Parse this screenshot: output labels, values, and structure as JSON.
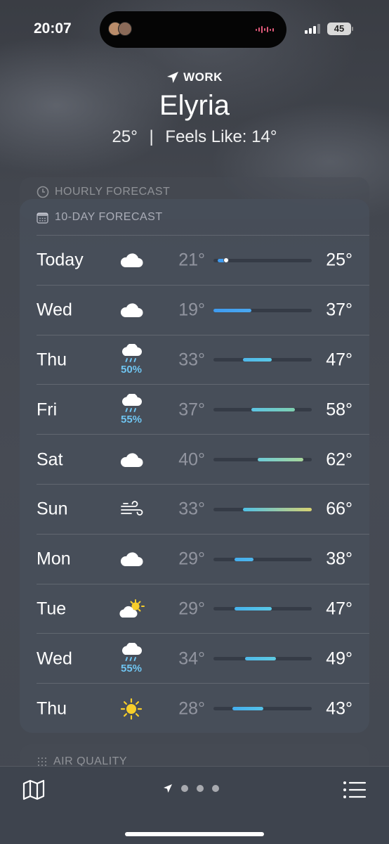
{
  "status": {
    "time": "20:07",
    "battery": "45"
  },
  "header": {
    "location_label": "WORK",
    "city": "Elyria",
    "current_temp": "25°",
    "separator": "|",
    "feels_like": "Feels Like: 14°"
  },
  "hourly": {
    "title": "HOURLY FORECAST"
  },
  "forecast": {
    "title": "10-DAY FORECAST",
    "range_min": 19,
    "range_max": 66,
    "days": [
      {
        "day": "Today",
        "icon": "cloud-icon",
        "precip": "",
        "low": "21°",
        "high": "25°",
        "low_value": 21,
        "high_value": 25,
        "current_value": 25,
        "colors": [
          "#3e9bf0",
          "#3e9bf0"
        ]
      },
      {
        "day": "Wed",
        "icon": "cloud-icon",
        "precip": "",
        "low": "19°",
        "high": "37°",
        "low_value": 19,
        "high_value": 37,
        "current_value": null,
        "colors": [
          "#3e9bf0",
          "#4aa8f0"
        ]
      },
      {
        "day": "Thu",
        "icon": "rain-cloud-icon",
        "precip": "50%",
        "low": "33°",
        "high": "47°",
        "low_value": 33,
        "high_value": 47,
        "current_value": null,
        "colors": [
          "#4fb7ea",
          "#5ac8e6"
        ]
      },
      {
        "day": "Fri",
        "icon": "rain-cloud-icon",
        "precip": "55%",
        "low": "37°",
        "high": "58°",
        "low_value": 37,
        "high_value": 58,
        "current_value": null,
        "colors": [
          "#5cc4e4",
          "#7fd0b0"
        ]
      },
      {
        "day": "Sat",
        "icon": "cloud-icon",
        "precip": "",
        "low": "40°",
        "high": "62°",
        "low_value": 40,
        "high_value": 62,
        "current_value": null,
        "colors": [
          "#6ccbd8",
          "#a8d69a"
        ]
      },
      {
        "day": "Sun",
        "icon": "wind-icon",
        "precip": "",
        "low": "33°",
        "high": "66°",
        "low_value": 33,
        "high_value": 66,
        "current_value": null,
        "colors": [
          "#4fc1e6",
          "#d8d271"
        ]
      },
      {
        "day": "Mon",
        "icon": "cloud-icon",
        "precip": "",
        "low": "29°",
        "high": "38°",
        "low_value": 29,
        "high_value": 38,
        "current_value": null,
        "colors": [
          "#44aeee",
          "#4eb6ec"
        ]
      },
      {
        "day": "Tue",
        "icon": "partly-sunny-icon",
        "precip": "",
        "low": "29°",
        "high": "47°",
        "low_value": 29,
        "high_value": 47,
        "current_value": null,
        "colors": [
          "#46b2ec",
          "#5ac8e6"
        ]
      },
      {
        "day": "Wed",
        "icon": "rain-cloud-icon",
        "precip": "55%",
        "low": "34°",
        "high": "49°",
        "low_value": 34,
        "high_value": 49,
        "current_value": null,
        "colors": [
          "#4fb9ea",
          "#5ecbe2"
        ]
      },
      {
        "day": "Thu",
        "icon": "sun-icon",
        "precip": "",
        "low": "28°",
        "high": "43°",
        "low_value": 28,
        "high_value": 43,
        "current_value": null,
        "colors": [
          "#44aeee",
          "#55c2e8"
        ]
      }
    ]
  },
  "air_quality": {
    "title": "AIR QUALITY"
  },
  "colors": {
    "accent_precip": "#6fc4f0",
    "sun": "#f7ce2a"
  }
}
